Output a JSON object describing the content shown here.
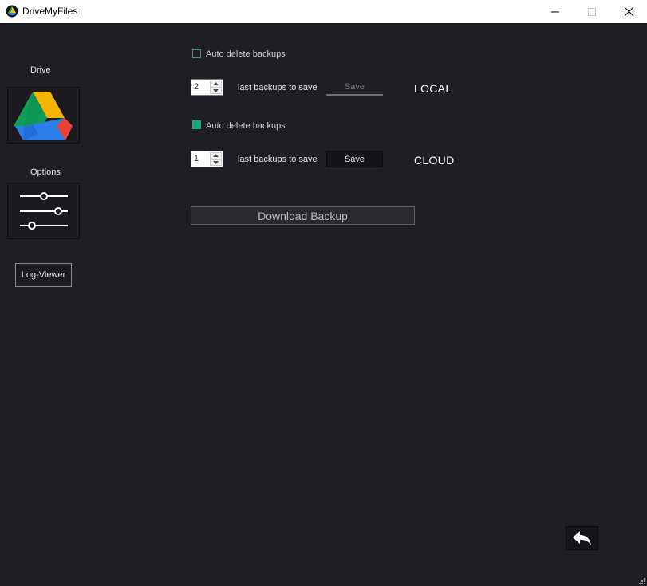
{
  "window": {
    "title": "DriveMyFiles",
    "app_icon": "drivemyfiles-app-icon",
    "controls": [
      "minimize-icon",
      "maximize-icon",
      "close-icon"
    ]
  },
  "sidebar": {
    "drive_label": "Drive",
    "drive_icon": "google-drive-icon",
    "options_label": "Options",
    "options_icon": "sliders-icon",
    "log_viewer_label": "Log-Viewer"
  },
  "local": {
    "auto_delete_label": "Auto delete backups",
    "auto_delete_checked": false,
    "backups_count": "2",
    "backups_label": "last backups to save",
    "save_label": "Save",
    "save_enabled": false,
    "section_label": "LOCAL"
  },
  "cloud": {
    "auto_delete_label": "Auto delete backups",
    "auto_delete_checked": true,
    "backups_count": "1",
    "backups_label": "last backups to save",
    "save_label": "Save",
    "save_enabled": true,
    "section_label": "CLOUD"
  },
  "download_label": "Download Backup",
  "back_icon": "reply-arrow-icon",
  "colors": {
    "background": "#1f1e24",
    "accent": "#16a87e",
    "titlebar": "#ffffff"
  }
}
